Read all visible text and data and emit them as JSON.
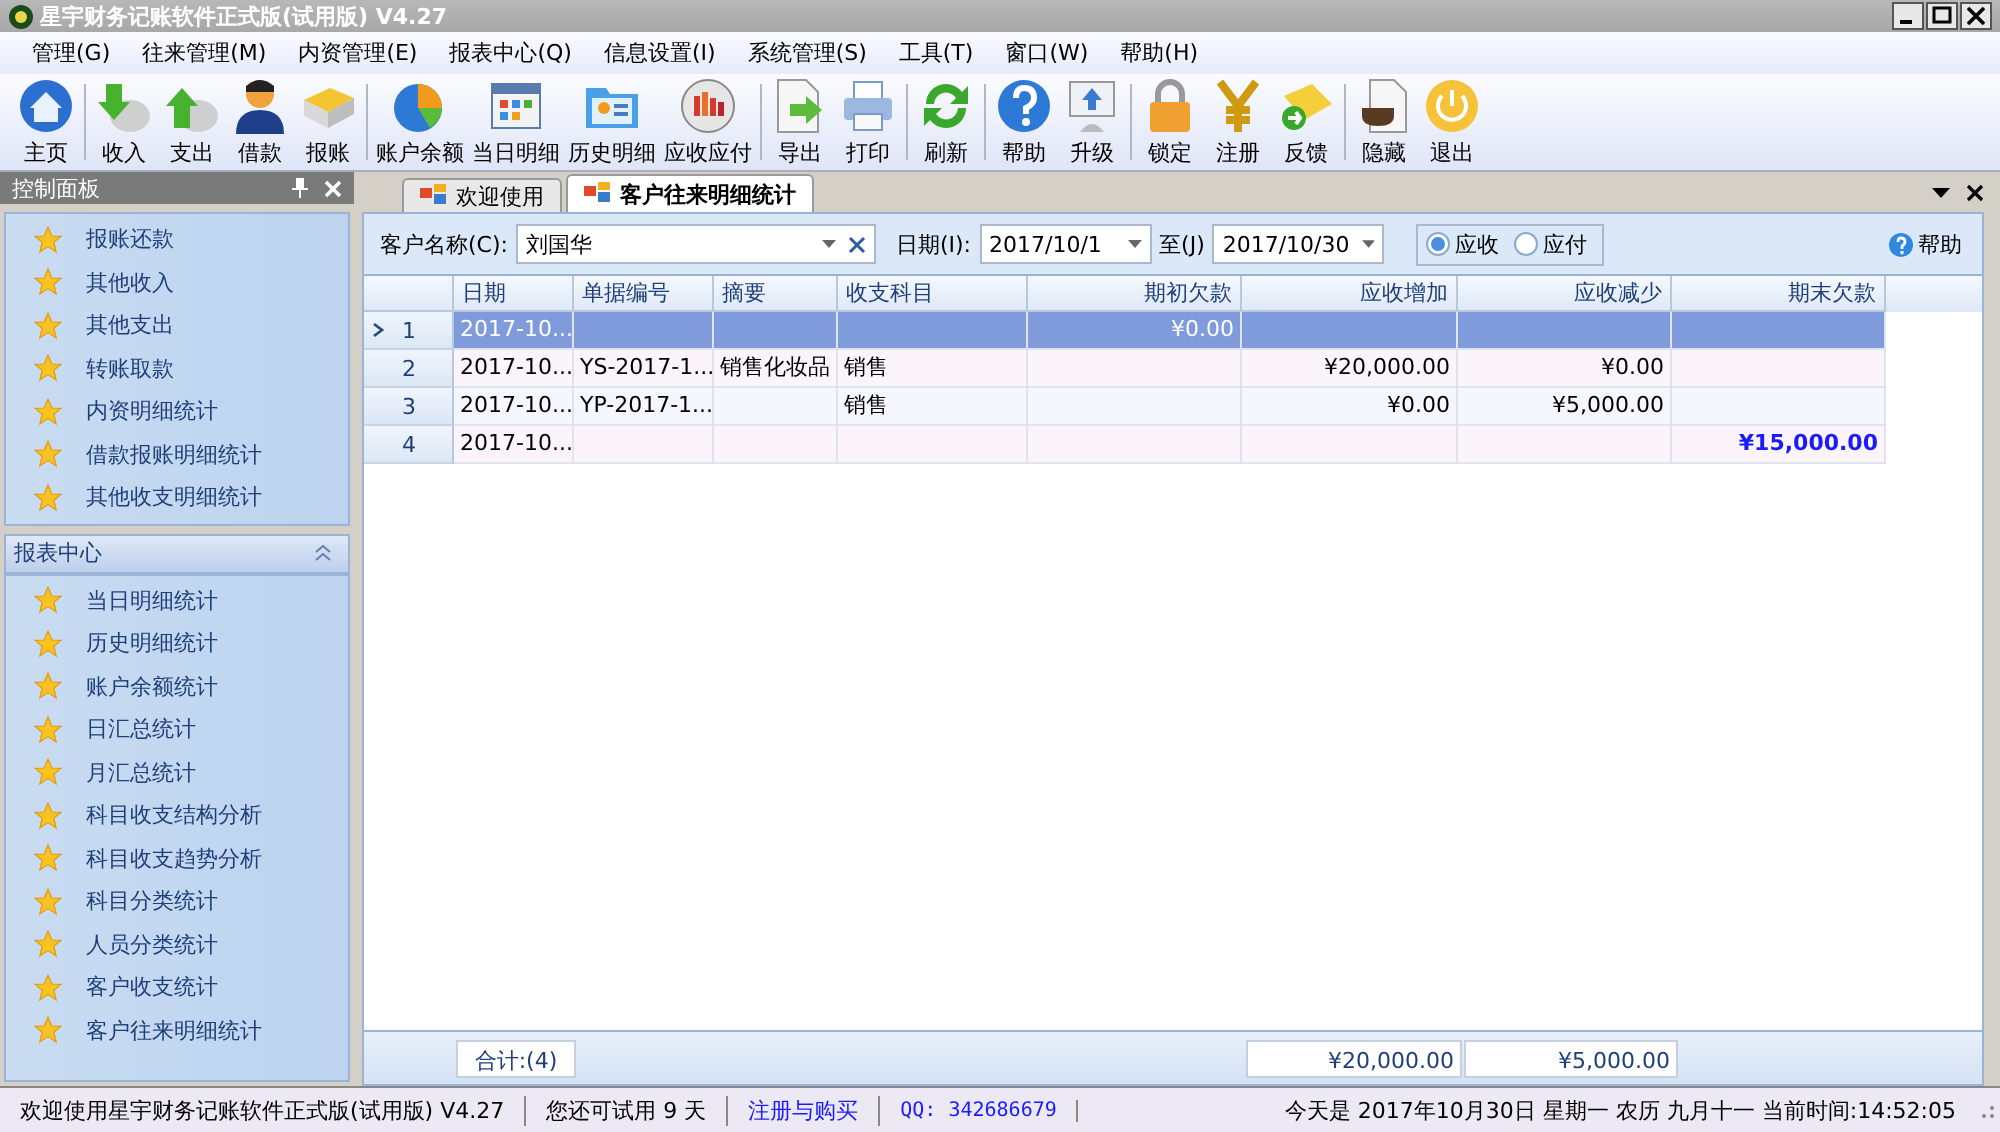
{
  "window": {
    "title": "星宇财务记账软件正式版(试用版) V4.27"
  },
  "menu": [
    "管理(G)",
    "往来管理(M)",
    "内资管理(E)",
    "报表中心(Q)",
    "信息设置(I)",
    "系统管理(S)",
    "工具(T)",
    "窗口(W)",
    "帮助(H)"
  ],
  "toolbar": [
    [
      "主页"
    ],
    [
      "收入",
      "支出",
      "借款",
      "报账"
    ],
    [
      "账户余额",
      "当日明细",
      "历史明细",
      "应收应付"
    ],
    [
      "导出",
      "打印"
    ],
    [
      "刷新"
    ],
    [
      "帮助",
      "升级"
    ],
    [
      "锁定",
      "注册",
      "反馈"
    ],
    [
      "隐藏",
      "退出"
    ]
  ],
  "sidebar": {
    "title": "控制面板",
    "items": [
      "报账还款",
      "其他收入",
      "其他支出",
      "转账取款",
      "内资明细统计",
      "借款报账明细统计",
      "其他收支明细统计"
    ],
    "section": {
      "title": "报表中心",
      "expanded": true,
      "items": [
        "当日明细统计",
        "历史明细统计",
        "账户余额统计",
        "日汇总统计",
        "月汇总统计",
        "科目收支结构分析",
        "科目收支趋势分析",
        "科目分类统计",
        "人员分类统计",
        "客户收支统计",
        "客户往来明细统计"
      ]
    }
  },
  "tabs": [
    {
      "label": "欢迎使用",
      "selected": false
    },
    {
      "label": "客户往来明细统计",
      "selected": true
    }
  ],
  "filter": {
    "customer_label": "客户名称(C):",
    "customer_value": "刘国华",
    "date_label": "日期(I):",
    "date_from": "2017/10/1",
    "to_label": "至(J)",
    "date_to": "2017/10/30",
    "radios": [
      {
        "label": "应收",
        "selected": true
      },
      {
        "label": "应付",
        "selected": false
      }
    ],
    "help_label": "帮助"
  },
  "table": {
    "columns": [
      "日期",
      "单据编号",
      "摘要",
      "收支科目",
      "期初欠款",
      "应收增加",
      "应收减少",
      "期末欠款"
    ],
    "rows": [
      {
        "number": "1",
        "selected": true,
        "cells": [
          "2017-10...",
          "",
          "",
          "",
          "¥0.00",
          "",
          "",
          ""
        ]
      },
      {
        "number": "2",
        "selected": false,
        "cells": [
          "2017-10...",
          "YS-2017-1...",
          "销售化妆品",
          "销售",
          "",
          "¥20,000.00",
          "¥0.00",
          ""
        ]
      },
      {
        "number": "3",
        "selected": false,
        "cells": [
          "2017-10...",
          "YP-2017-1...",
          "",
          "销售",
          "",
          "¥0.00",
          "¥5,000.00",
          ""
        ]
      },
      {
        "number": "4",
        "selected": false,
        "cells": [
          "2017-10...",
          "",
          "",
          "",
          "",
          "",
          "",
          "¥15,000.00"
        ]
      }
    ],
    "footer": {
      "count": "合计:(4)",
      "total_increase": "¥20,000.00",
      "total_decrease": "¥5,000.00"
    }
  },
  "status_bar": [
    {
      "kind": "plain",
      "text": "欢迎使用星宇财务记账软件正式版(试用版) V4.27"
    },
    {
      "kind": "plain",
      "text": "您还可试用 9 天"
    },
    {
      "kind": "link",
      "text": "注册与购买"
    },
    {
      "kind": "qq",
      "text": "QQ: 342686679"
    },
    {
      "kind": "right",
      "text": "今天是 2017年10月30日 星期一 农历 九月十一 当前时间:14:52:05"
    }
  ]
}
